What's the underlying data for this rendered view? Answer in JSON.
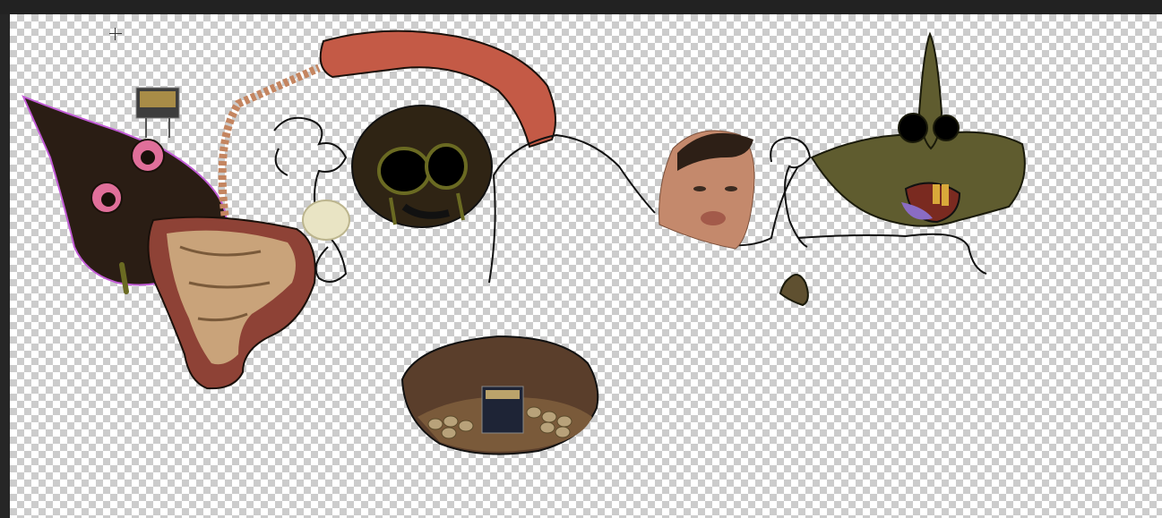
{
  "app": {
    "theme_bar_color": "#222222",
    "canvas_transparency": "checkerboard"
  },
  "canvas": {
    "content": "collage-illustration",
    "colors": {
      "skin_brown": "#2a1d14",
      "eye_pink": "#e06f9a",
      "mouth_red": "#8e4236",
      "sausage": "#c45a46",
      "olive": "#5f5c2f",
      "bowl_brown": "#5a3e2b"
    }
  },
  "tool": {
    "cursor_icon": "crosshair-icon"
  }
}
